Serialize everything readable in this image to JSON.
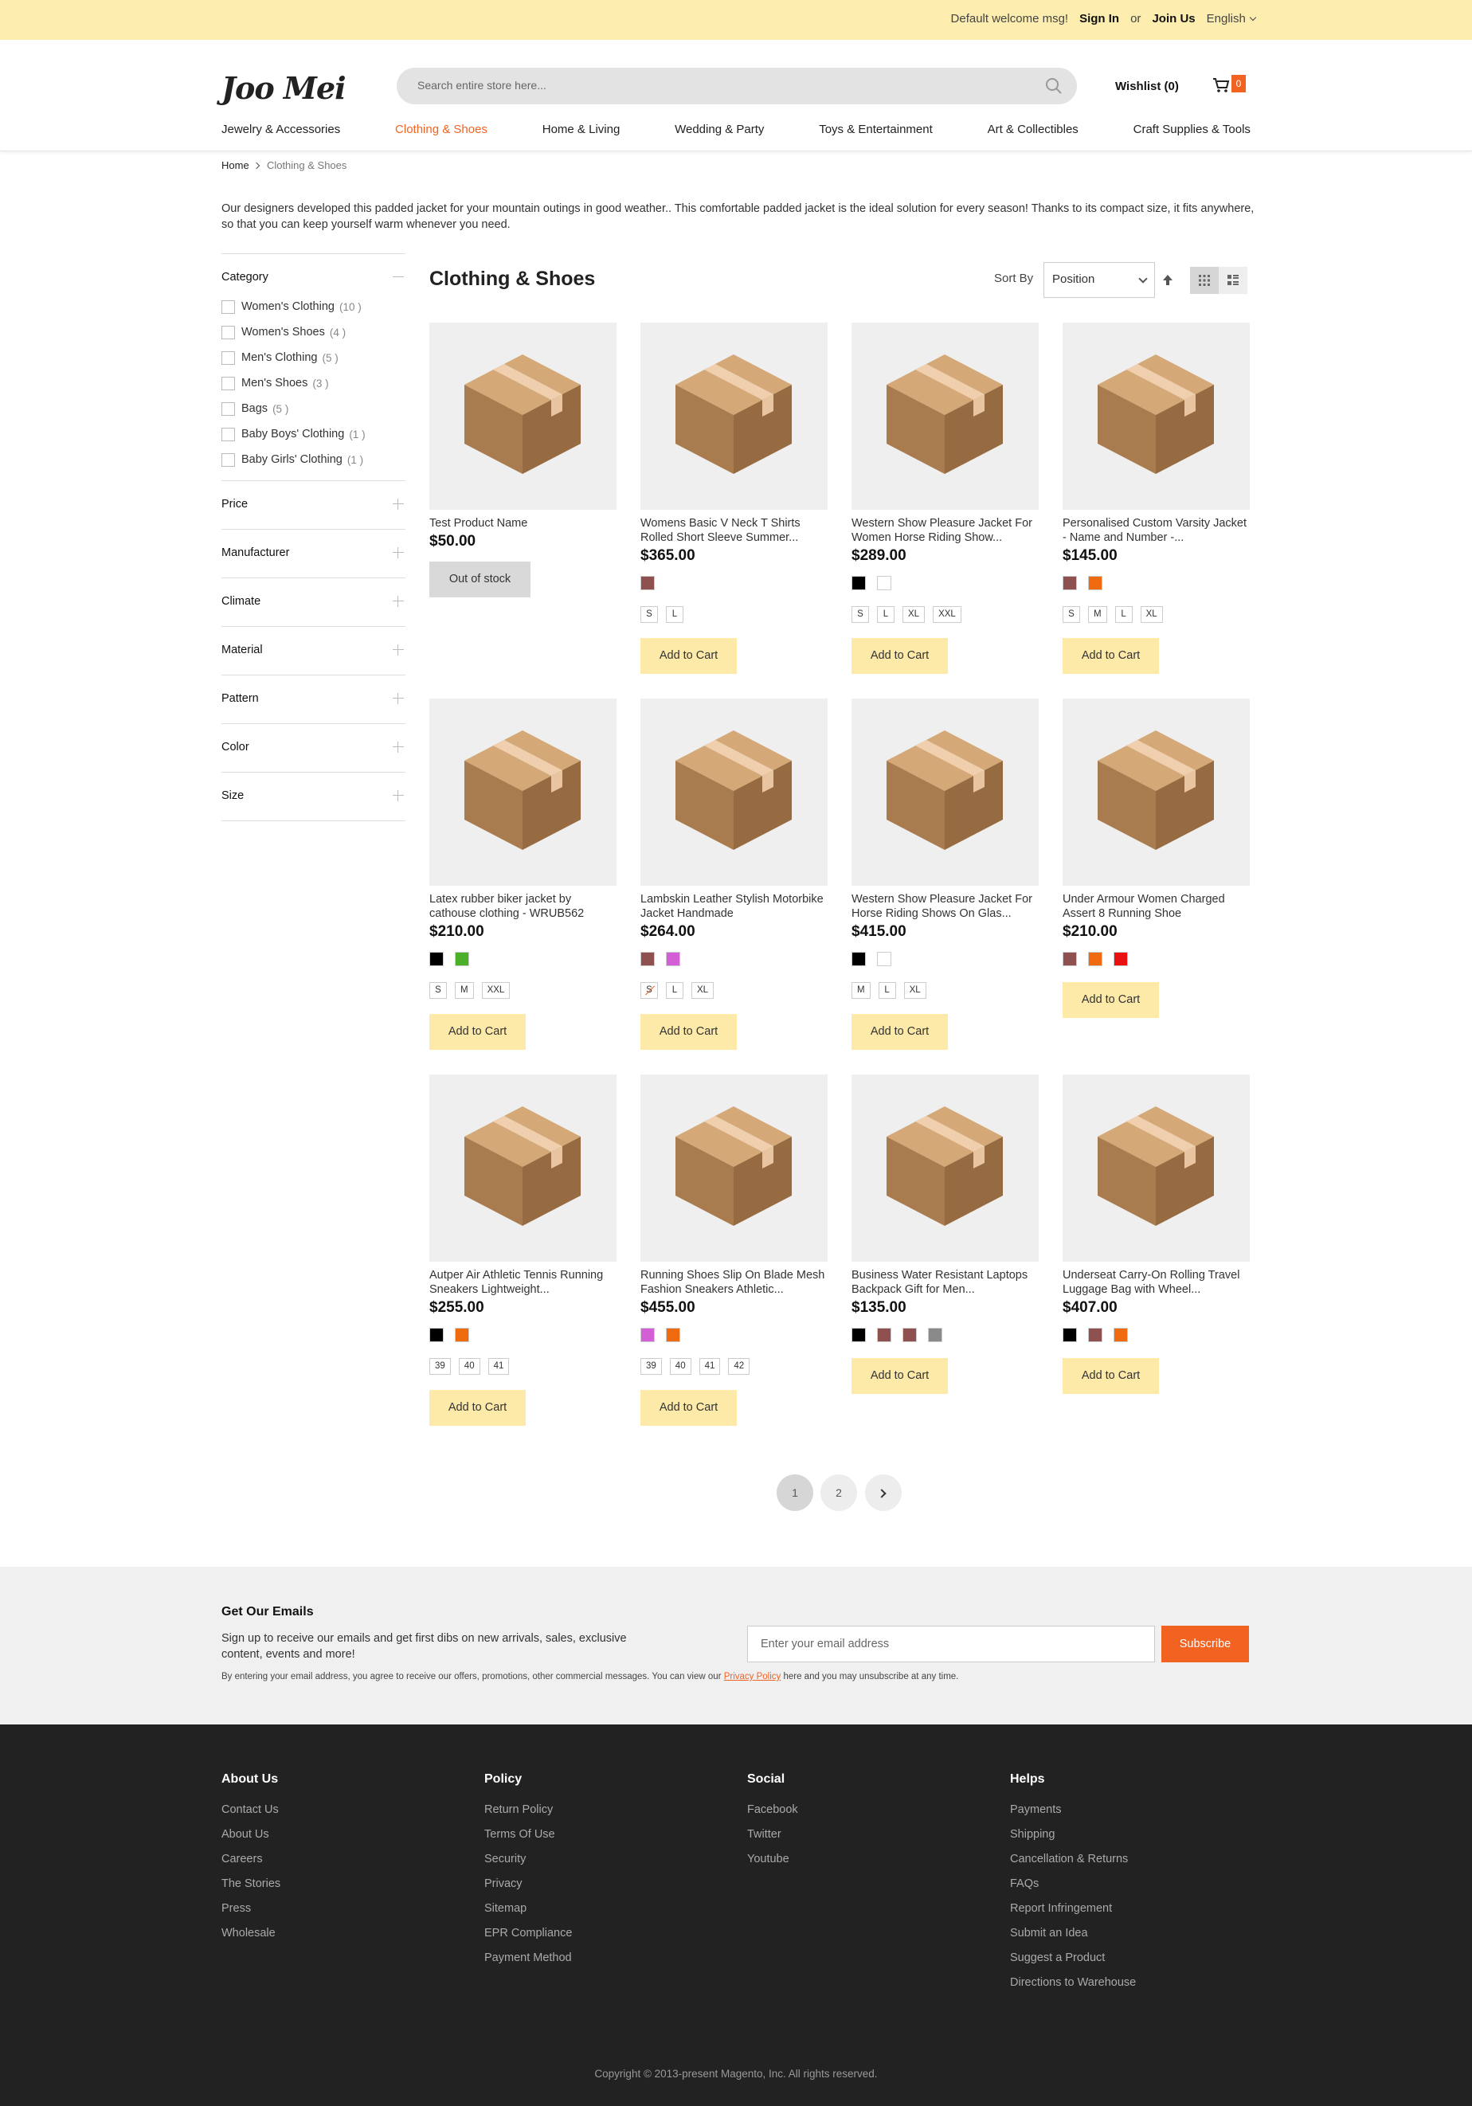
{
  "topbar": {
    "welcome": "Default welcome msg!",
    "sign_in": "Sign In",
    "or": "or",
    "join": "Join Us",
    "language": "English"
  },
  "header": {
    "logo_a": "Joo",
    "logo_b": "Mei",
    "search_placeholder": "Search entire store here...",
    "wishlist": "Wishlist (0)",
    "cart_count": "0",
    "nav": [
      "Jewelry & Accessories",
      "Clothing & Shoes",
      "Home & Living",
      "Wedding & Party",
      "Toys & Entertainment",
      "Art & Collectibles",
      "Craft Supplies & Tools"
    ],
    "nav_active": "Clothing & Shoes"
  },
  "breadcrumb": {
    "home": "Home",
    "current": "Clothing & Shoes"
  },
  "category_description": "Our designers developed this padded jacket for your mountain outings in good weather.. This comfortable padded jacket is the ideal solution for every season! Thanks to its compact size, it fits anywhere, so that you can keep yourself warm whenever you need.",
  "sidebar": {
    "category_title": "Category",
    "categories": [
      {
        "label": "Women's Clothing",
        "count": "(10 )"
      },
      {
        "label": "Women's Shoes",
        "count": "(4 )"
      },
      {
        "label": "Men's Clothing",
        "count": "(5 )"
      },
      {
        "label": "Men's Shoes",
        "count": "(3 )"
      },
      {
        "label": "Bags",
        "count": "(5 )"
      },
      {
        "label": "Baby Boys' Clothing",
        "count": "(1 )"
      },
      {
        "label": "Baby Girls' Clothing",
        "count": "(1 )"
      }
    ],
    "filters": [
      "Price",
      "Manufacturer",
      "Climate",
      "Material",
      "Pattern",
      "Color",
      "Size"
    ]
  },
  "main": {
    "title": "Clothing & Shoes",
    "sort_label": "Sort By",
    "sort_value": "Position",
    "add_to_cart": "Add to Cart",
    "out_of_stock": "Out of stock"
  },
  "colors": {
    "accent": "#f26322",
    "topbar_bg": "#fdeeb0",
    "button_bg": "#fde9a8",
    "footer_bg": "#222222",
    "newsletter_bg": "#f0f0f0"
  },
  "products": [
    {
      "name": "Test Product Name",
      "price": "$50.00",
      "swatches": [],
      "sizes": [],
      "stock": "out"
    },
    {
      "name": "Womens Basic V Neck T Shirts Rolled Short Sleeve Summer...",
      "price": "$365.00",
      "swatches": [
        "#8f5050"
      ],
      "sizes": [
        "S",
        "L"
      ]
    },
    {
      "name": "Western Show Pleasure Jacket For Women Horse Riding Show...",
      "price": "$289.00",
      "swatches": [
        "#000000",
        "#ffffff"
      ],
      "sizes": [
        "S",
        "L",
        "XL",
        "XXL"
      ]
    },
    {
      "name": "Personalised Custom Varsity Jacket - Name and Number -...",
      "price": "$145.00",
      "swatches": [
        "#8f5050",
        "#f06a0f"
      ],
      "sizes": [
        "S",
        "M",
        "L",
        "XL"
      ]
    },
    {
      "name": "Latex rubber biker jacket by cathouse clothing - WRUB562",
      "price": "$210.00",
      "swatches": [
        "#000000",
        "#4caf2a"
      ],
      "sizes": [
        "S",
        "M",
        "XXL"
      ]
    },
    {
      "name": "Lambskin Leather Stylish Motorbike Jacket Handmade",
      "price": "$264.00",
      "swatches": [
        "#8f5050",
        "#d45fd4"
      ],
      "sizes": [
        "S",
        "L",
        "XL"
      ],
      "disabled_size": "S"
    },
    {
      "name": "Western Show Pleasure Jacket For Horse Riding Shows On Glas...",
      "price": "$415.00",
      "swatches": [
        "#000000",
        "#ffffff"
      ],
      "sizes": [
        "M",
        "L",
        "XL"
      ]
    },
    {
      "name": "Under Armour Women Charged Assert 8 Running Shoe",
      "price": "$210.00",
      "swatches": [
        "#8f5050",
        "#f06a0f",
        "#e81010"
      ],
      "sizes": []
    },
    {
      "name": "Autper Air Athletic Tennis Running Sneakers Lightweight...",
      "price": "$255.00",
      "swatches": [
        "#000000",
        "#f06a0f"
      ],
      "sizes": [
        "39",
        "40",
        "41"
      ]
    },
    {
      "name": "Running Shoes Slip On Blade Mesh Fashion Sneakers Athletic...",
      "price": "$455.00",
      "swatches": [
        "#d45fd4",
        "#f06a0f"
      ],
      "sizes": [
        "39",
        "40",
        "41",
        "42"
      ]
    },
    {
      "name": "Business Water Resistant Laptops Backpack Gift for Men...",
      "price": "$135.00",
      "swatches": [
        "#000000",
        "#8f5050",
        "#8f5050",
        "#8a8a8a"
      ],
      "sizes": []
    },
    {
      "name": "Underseat Carry-On Rolling Travel Luggage Bag with Wheel...",
      "price": "$407.00",
      "swatches": [
        "#000000",
        "#8f5050",
        "#f06a0f"
      ],
      "sizes": []
    }
  ],
  "pagination": {
    "pages": [
      "1",
      "2"
    ],
    "current": "1"
  },
  "newsletter": {
    "title": "Get Our Emails",
    "text": "Sign up to receive our emails and get first dibs on new arrivals, sales, exclusive content, events and more!",
    "legal_a": "By entering your email address, you agree to receive our offers, promotions, other commercial messages. You can view our ",
    "legal_link": "Privacy Policy",
    "legal_b": " here and you may unsubscribe at any time.",
    "placeholder": "Enter your email address",
    "button": "Subscribe"
  },
  "footer": {
    "columns": [
      {
        "title": "About Us",
        "links": [
          "Contact Us",
          "About Us",
          "Careers",
          "The Stories",
          "Press",
          "Wholesale"
        ]
      },
      {
        "title": "Policy",
        "links": [
          "Return Policy",
          "Terms Of Use",
          "Security",
          "Privacy",
          "Sitemap",
          "EPR Compliance",
          "Payment Method"
        ]
      },
      {
        "title": "Social",
        "links": [
          "Facebook",
          "Twitter",
          "Youtube"
        ]
      },
      {
        "title": "Helps",
        "links": [
          "Payments",
          "Shipping",
          "Cancellation & Returns",
          "FAQs",
          "Report Infringement",
          "Submit an Idea",
          "Suggest a Product",
          "Directions to Warehouse"
        ]
      }
    ],
    "copyright": "Copyright © 2013-present Magento, Inc. All rights reserved."
  }
}
